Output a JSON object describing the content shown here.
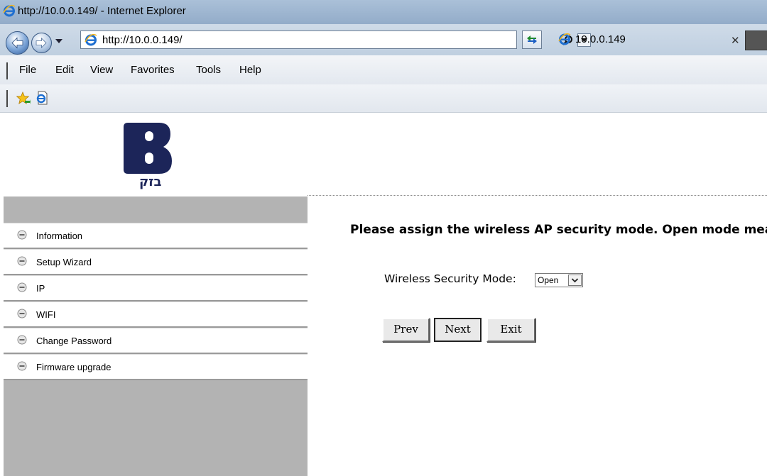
{
  "browser": {
    "window_title": "http://10.0.0.149/ - Internet Explorer",
    "address_url": "http://10.0.0.149/",
    "tab_title": "10.0.0.149",
    "menu": [
      "File",
      "Edit",
      "View",
      "Favorites",
      "Tools",
      "Help"
    ],
    "icons": [
      "ie-logo-icon",
      "back-arrow-icon",
      "forward-arrow-icon",
      "search-icon",
      "refresh-icon",
      "favorites-star-icon",
      "page-icon",
      "close-icon"
    ]
  },
  "logo": {
    "text": "בזק"
  },
  "sidebar": {
    "items": [
      {
        "label": "Information"
      },
      {
        "label": "Setup Wizard"
      },
      {
        "label": "IP"
      },
      {
        "label": "WIFI"
      },
      {
        "label": "Change Password"
      },
      {
        "label": "Firmware upgrade"
      }
    ]
  },
  "main": {
    "instruction": "Please assign the wireless AP security mode. Open mode mea",
    "security_label": "Wireless Security Mode:",
    "security_value": "Open",
    "buttons": {
      "prev": "Prev",
      "next": "Next",
      "exit": "Exit"
    }
  },
  "colors": {
    "sidebar_bg": "#b3b3b3",
    "logo_blue": "#1c2559",
    "titlebar": "#9cb4cf"
  }
}
